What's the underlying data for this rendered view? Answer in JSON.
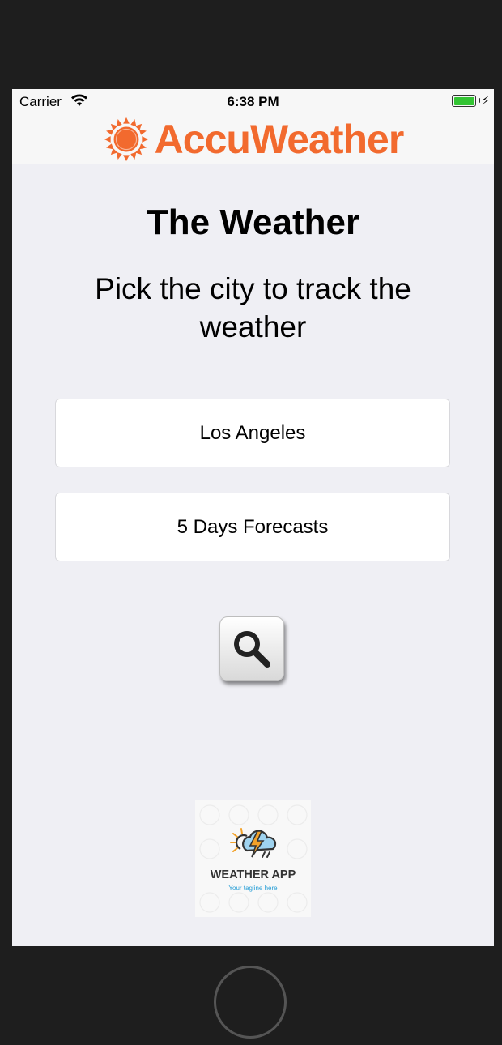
{
  "status_bar": {
    "carrier": "Carrier",
    "time": "6:38 PM",
    "wifi_icon": "wifi-icon",
    "battery_icon": "battery-icon",
    "charging_icon": "bolt-icon"
  },
  "nav": {
    "brand": "AccuWeather",
    "logo_icon": "sun-icon",
    "brand_color": "#f26a2e"
  },
  "main": {
    "title": "The Weather",
    "subtitle": "Pick the city to track the weather",
    "city_button": "Los Angeles",
    "forecast_button": "5 Days Forecasts",
    "search_icon": "magnifier-icon"
  },
  "app_logo": {
    "title": "WEATHER APP",
    "tagline": "Your tagline here",
    "icon": "storm-cloud-icon"
  },
  "colors": {
    "background": "#efeff4",
    "bar": "#f7f7f7",
    "accent": "#f26a2e",
    "battery": "#33c433"
  }
}
